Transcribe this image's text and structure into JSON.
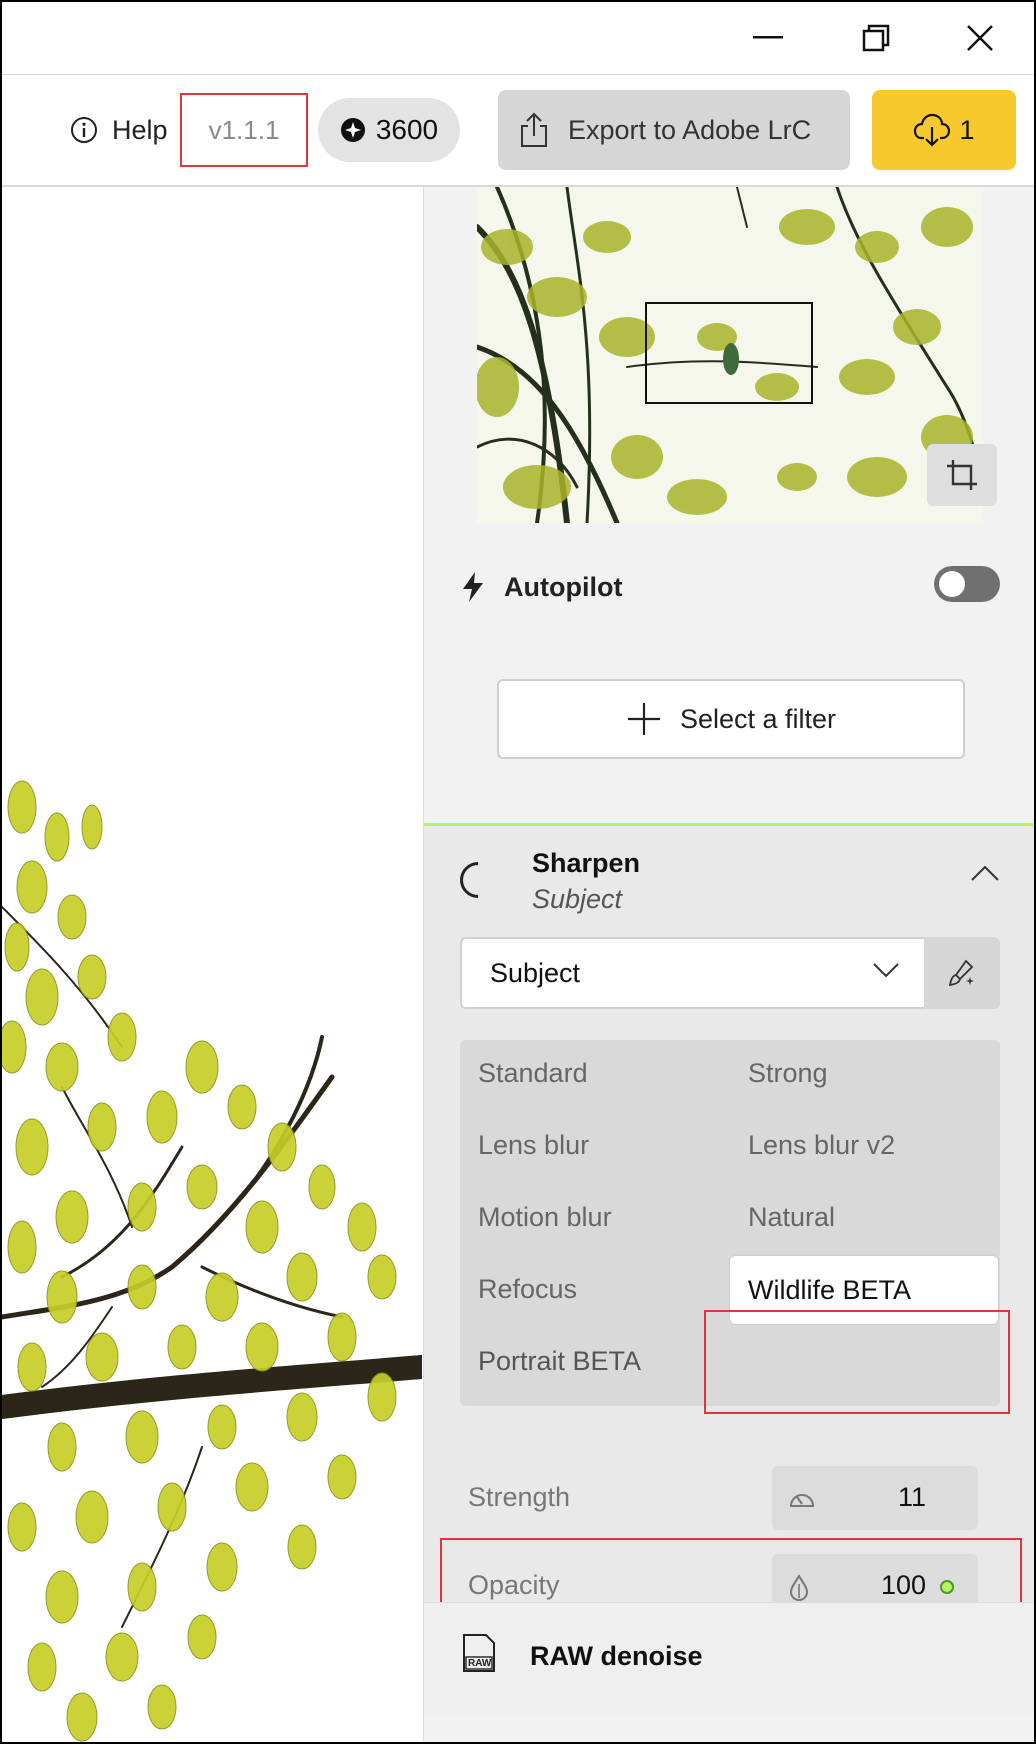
{
  "window": {
    "minimize_icon": "minimize-icon",
    "restore_icon": "restore-icon",
    "close_icon": "close-icon"
  },
  "toolbar": {
    "help_label": "Help",
    "version": "v1.1.1",
    "credits": "3600",
    "export_label": "Export to Adobe LrC",
    "download_count": "1",
    "accent_color": "#f8c92c"
  },
  "autopilot": {
    "label": "Autopilot",
    "enabled": false
  },
  "add_filter": {
    "label": "Select a filter"
  },
  "sharpen": {
    "title": "Sharpen",
    "subtitle": "Subject",
    "mode": "Subject",
    "models": [
      {
        "label": "Standard"
      },
      {
        "label": "Strong"
      },
      {
        "label": "Lens blur"
      },
      {
        "label": "Lens blur v2"
      },
      {
        "label": "Motion blur"
      },
      {
        "label": "Natural"
      },
      {
        "label": "Refocus"
      },
      {
        "label": "Wildlife BETA",
        "selected": true
      },
      {
        "label": "Portrait BETA"
      }
    ],
    "strength": {
      "label": "Strength",
      "value": "11"
    },
    "opacity": {
      "label": "Opacity",
      "value": "100"
    }
  },
  "raw_denoise": {
    "label": "RAW denoise"
  }
}
